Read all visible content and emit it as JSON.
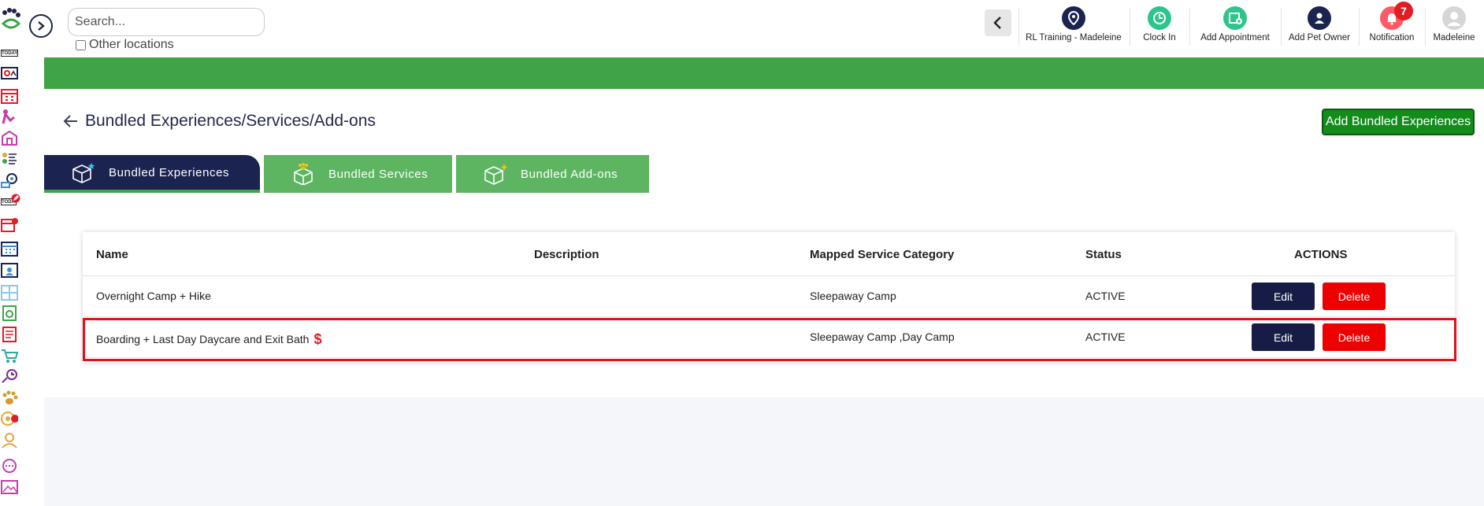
{
  "search": {
    "placeholder": "Search...",
    "other_locations_label": "Other locations"
  },
  "topbar": {
    "items": [
      {
        "label": "RL Training - Madeleine",
        "icon": "location-pin-icon"
      },
      {
        "label": "Clock In",
        "icon": "clock-icon"
      },
      {
        "label": "Add Appointment",
        "icon": "calendar-add-icon"
      },
      {
        "label": "Add Pet Owner",
        "icon": "user-add-icon"
      },
      {
        "label": "Notification",
        "icon": "bell-icon",
        "badge": "7"
      },
      {
        "label": "Madeleine",
        "icon": "avatar-icon"
      }
    ]
  },
  "sidebar": {
    "items": [
      "today-icon",
      "dashboard-icon",
      "calendar-grid-icon",
      "grooming-icon",
      "kennel-icon",
      "staff-icon",
      "map-pin-icon",
      "today-edit-icon",
      "calendar-edit-icon",
      "calendar-icon",
      "calendar-user-icon",
      "layout-icon",
      "checklist-icon",
      "document-icon",
      "cart-icon",
      "alarm-icon",
      "paw-icon",
      "target-icon",
      "user-icon",
      "chat-icon",
      "image-icon"
    ]
  },
  "page": {
    "title": "Bundled Experiences/Services/Add-ons",
    "add_button": "Add Bundled Experiences"
  },
  "tabs": [
    {
      "label": "Bundled Experiences",
      "active": true
    },
    {
      "label": "Bundled Services",
      "active": false
    },
    {
      "label": "Bundled Add-ons",
      "active": false
    }
  ],
  "table": {
    "columns": [
      "Name",
      "Description",
      "Mapped Service Category",
      "Status",
      "ACTIONS"
    ],
    "rows": [
      {
        "name": "Overnight Camp + Hike",
        "description": "",
        "category": "Sleepaway Camp",
        "status": "ACTIVE",
        "edit": "Edit",
        "delete": "Delete",
        "price_flag": ""
      },
      {
        "name": "Boarding + Last Day Daycare and Exit Bath",
        "description": "",
        "category": "Sleepaway Camp ,Day Camp",
        "status": "ACTIVE",
        "edit": "Edit",
        "delete": "Delete",
        "price_flag": "$"
      }
    ]
  },
  "colors": {
    "green": "#40a348",
    "navy": "#1b2350",
    "red": "#ee0000",
    "highlight": "#e0111a"
  }
}
